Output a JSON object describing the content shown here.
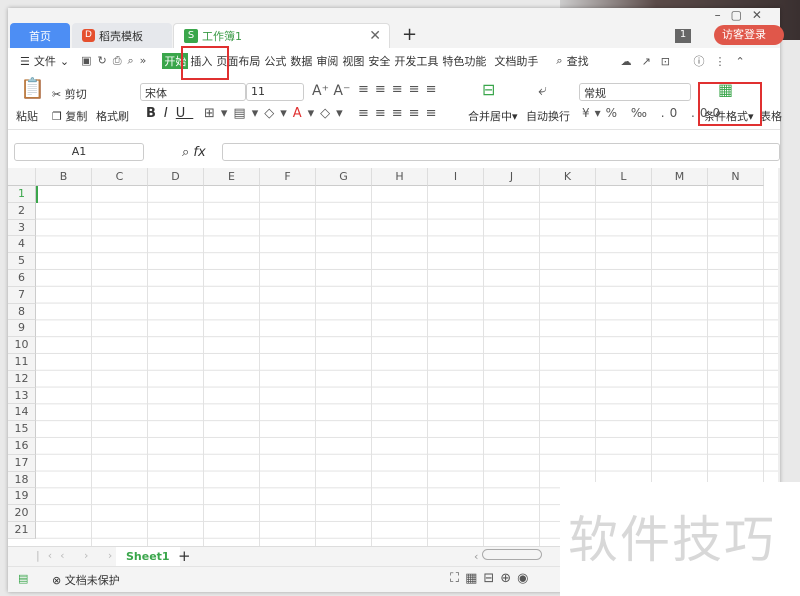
{
  "tabs": {
    "home": "首页",
    "template": "稻壳模板",
    "workbook": "工作簿1",
    "new_tab": "+",
    "badge": "1",
    "login": "访客登录"
  },
  "menu": {
    "file": "文件",
    "items": [
      "开始",
      "插入",
      "页面布局",
      "公式",
      "数据",
      "审阅",
      "视图",
      "安全",
      "开发工具",
      "特色功能",
      "文档助手"
    ],
    "find": "查找"
  },
  "ribbon": {
    "paste": "粘贴",
    "cut": "剪切",
    "copy": "复制",
    "format_painter": "格式刷",
    "font": "宋体",
    "size": "11",
    "bold": "B",
    "italic": "I",
    "underline": "U",
    "merge": "合并居中",
    "wrap": "自动换行",
    "number_format": "常规",
    "conditional_format": "条件格式",
    "table": "表格"
  },
  "formula_bar": {
    "cell_ref": "A1",
    "fx": "fx",
    "value": ""
  },
  "columns": [
    "B",
    "C",
    "D",
    "E",
    "F",
    "G",
    "H",
    "I",
    "J",
    "K",
    "L",
    "M",
    "N"
  ],
  "rows": [
    "1",
    "2",
    "3",
    "4",
    "5",
    "6",
    "7",
    "8",
    "9",
    "10",
    "11",
    "12",
    "13",
    "14",
    "15",
    "16",
    "17",
    "18",
    "19",
    "20",
    "21"
  ],
  "sheets": [
    {
      "name": "Sheet1",
      "active": true
    }
  ],
  "status": {
    "protect": "文档未保护"
  },
  "watermark": "软件技巧",
  "colors": {
    "accent": "#3aa64b",
    "home_tab": "#4d8ef4",
    "login": "#e0574a",
    "highlight": "#e03030"
  }
}
